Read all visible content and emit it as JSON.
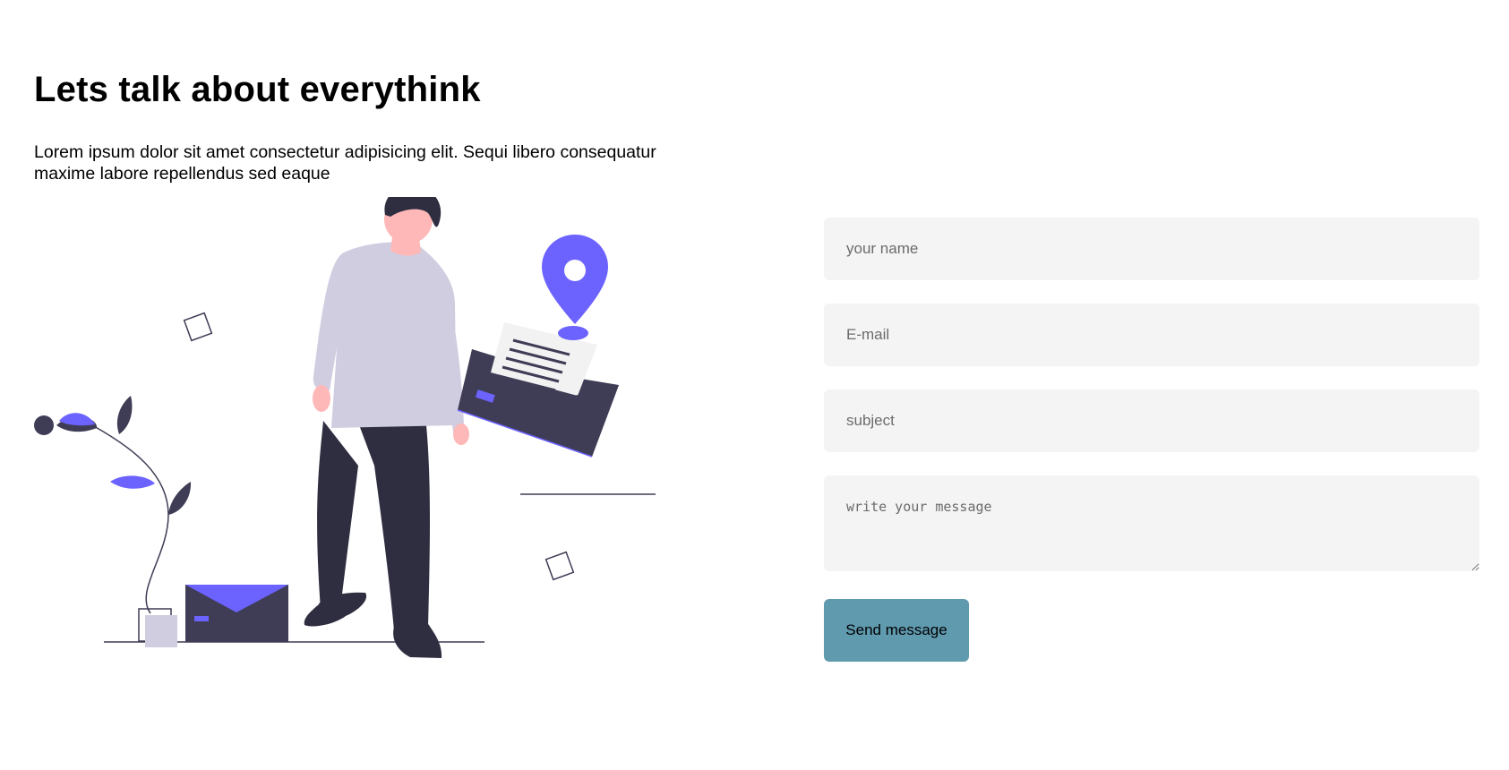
{
  "header": {
    "title": "Lets talk about everythink",
    "intro": "Lorem ipsum dolor sit amet consectetur adipisicing elit. Sequi libero consequatur maxime labore repellendus sed eaque"
  },
  "illustration": {
    "icon": "contact-illustration",
    "colors": {
      "accent": "#6c63ff",
      "dark": "#2f2e41",
      "envelope": "#3f3d56",
      "shirt": "#d0cde1",
      "skin": "#ffb8b8",
      "paper": "#f2f2f2"
    }
  },
  "form": {
    "name_placeholder": "your name",
    "email_placeholder": "E-mail",
    "subject_placeholder": "subject",
    "message_placeholder": "write your message",
    "submit_label": "Send message",
    "colors": {
      "field_bg": "#f4f4f4",
      "button_bg": "#5f9aaf"
    }
  }
}
